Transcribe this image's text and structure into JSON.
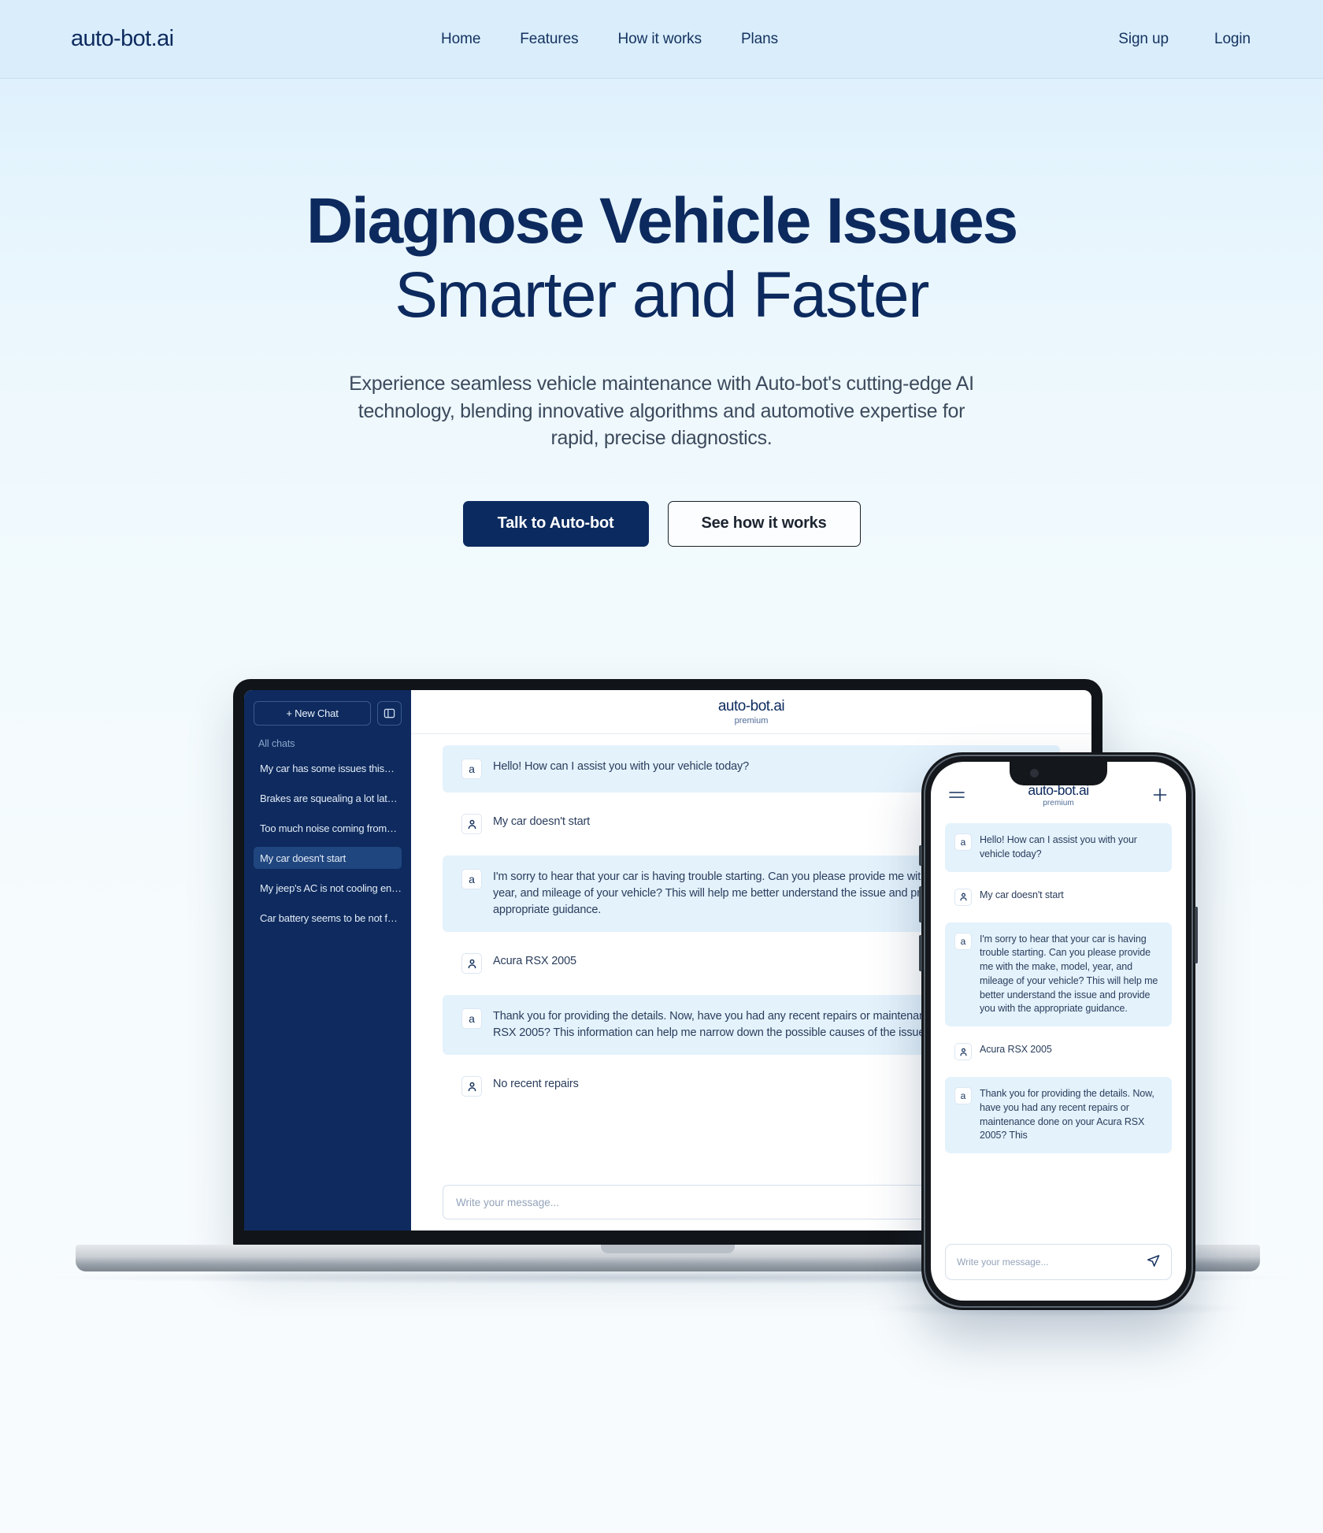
{
  "nav": {
    "brand": "auto-bot.ai",
    "links": [
      {
        "label": "Home"
      },
      {
        "label": "Features"
      },
      {
        "label": "How it works"
      },
      {
        "label": "Plans"
      }
    ],
    "signup": "Sign up",
    "login": "Login"
  },
  "hero": {
    "title_line1": "Diagnose Vehicle Issues",
    "title_line2": "Smarter and Faster",
    "paragraph": "Experience seamless vehicle maintenance with Auto-bot's cutting-edge AI technology, blending innovative algorithms and automotive expertise for rapid, precise diagnostics.",
    "cta_primary": "Talk to Auto-bot",
    "cta_secondary": "See how it works"
  },
  "laptop": {
    "sidebar": {
      "new_chat": "+ New Chat",
      "all_chats_label": "All chats",
      "items": [
        {
          "label": "My car has some issues this…",
          "active": false
        },
        {
          "label": "Brakes are squealing a lot lat…",
          "active": false
        },
        {
          "label": "Too much noise coming from…",
          "active": false
        },
        {
          "label": "My car doesn't start",
          "active": true
        },
        {
          "label": "My jeep's AC is not cooling en…",
          "active": false
        },
        {
          "label": "Car battery seems to be not f…",
          "active": false
        }
      ]
    },
    "header": {
      "logo": "auto-bot.ai",
      "plan": "premium"
    },
    "messages": [
      {
        "role": "bot",
        "avatar": "a",
        "text": "Hello! How can I assist you with your vehicle today?"
      },
      {
        "role": "user",
        "avatar": "person-icon",
        "text": "My car doesn't start"
      },
      {
        "role": "bot",
        "avatar": "a",
        "text": "I'm sorry to hear that your car is having trouble starting. Can you please provide me with the make, model, year, and mileage of your vehicle? This will help me better understand the issue and provide you with the appropriate guidance."
      },
      {
        "role": "user",
        "avatar": "person-icon",
        "text": "Acura RSX 2005"
      },
      {
        "role": "bot",
        "avatar": "a",
        "text": "Thank you for providing the details. Now, have you had any recent repairs or maintenance done on your Acura RSX 2005? This information can help me narrow down the possible causes of the issue."
      },
      {
        "role": "user",
        "avatar": "person-icon",
        "text": "No recent repairs"
      }
    ],
    "input_placeholder": "Write your message..."
  },
  "phone": {
    "header": {
      "logo": "auto-bot.ai",
      "plan": "premium",
      "menu_icon": "hamburger-icon",
      "new_icon": "plus-icon"
    },
    "messages": [
      {
        "role": "bot",
        "avatar": "a",
        "text": "Hello! How can I assist you with your vehicle today?"
      },
      {
        "role": "user",
        "avatar": "person-icon",
        "text": "My car doesn't start"
      },
      {
        "role": "bot",
        "avatar": "a",
        "text": "I'm sorry to hear that your car is having trouble starting. Can you please provide me with the make, model, year, and mileage of your vehicle? This will help me better understand the issue and provide you with the appropriate guidance."
      },
      {
        "role": "user",
        "avatar": "person-icon",
        "text": "Acura RSX 2005"
      },
      {
        "role": "bot",
        "avatar": "a",
        "text": "Thank you for providing the details. Now, have you had any recent repairs or maintenance done on your Acura RSX 2005? This"
      }
    ],
    "input_placeholder": "Write your message...",
    "send_icon": "send-icon"
  },
  "colors": {
    "brand_navy": "#0d2a5e",
    "sidebar_navy": "#0e2a5e",
    "bot_bubble": "#e4f2fc",
    "page_top": "#d9edfb"
  }
}
